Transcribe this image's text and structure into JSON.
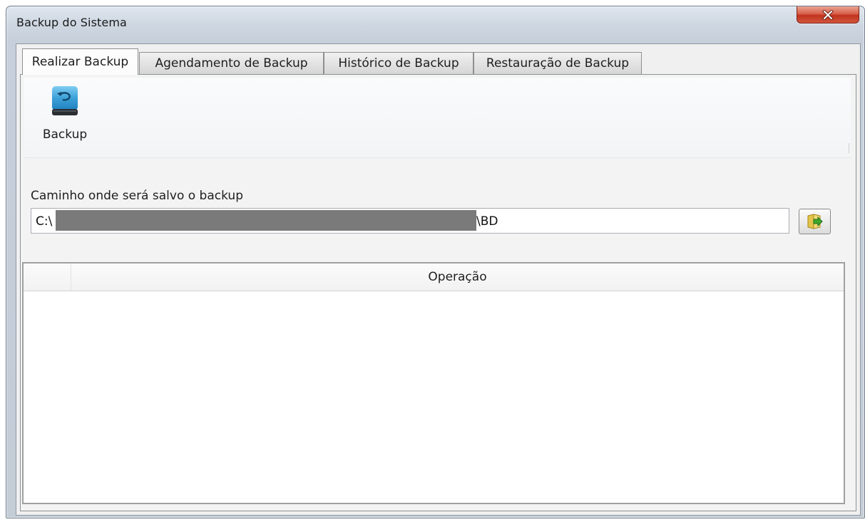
{
  "window": {
    "title": "Backup do Sistema",
    "close_symbol": "x"
  },
  "tabs": [
    {
      "label": "Realizar Backup",
      "active": true
    },
    {
      "label": "Agendamento de Backup",
      "active": false
    },
    {
      "label": "Histórico de Backup",
      "active": false
    },
    {
      "label": "Restauração de Backup",
      "active": false
    }
  ],
  "toolbar": {
    "backup_label": "Backup",
    "backup_icon": "backup-drive-icon"
  },
  "path": {
    "label": "Caminho onde será salvo o backup",
    "value_start": "C:\\",
    "value_end": "\\BD",
    "browse_icon": "folder-open-icon"
  },
  "grid": {
    "columns": [
      "Operação"
    ],
    "rows": []
  },
  "colors": {
    "close_button": "#c8412b",
    "drive_blue": "#3ba0d8",
    "folder_yellow": "#e3c44a",
    "arrow_green": "#3fa52a"
  }
}
